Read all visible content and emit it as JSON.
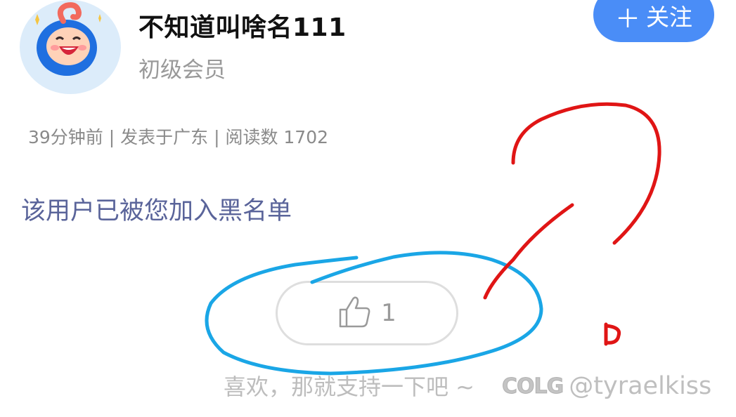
{
  "user": {
    "name": "不知道叫啥名111",
    "level": "初级会员"
  },
  "follow": {
    "icon": "plus-icon",
    "label": "关注",
    "color": "#4a8df7"
  },
  "post_meta": {
    "text": "39分钟前 | 发表于广东 | 阅读数 1702"
  },
  "content": {
    "blocked_notice": "该用户已被您加入黑名单"
  },
  "like": {
    "icon": "thumbs-up-icon",
    "count": "1"
  },
  "footer": {
    "support_text": "喜欢，那就支持一下吧 ~"
  },
  "watermark": {
    "logo": "COLG",
    "handle": "@tyraelkiss"
  },
  "annotations": {
    "blue_color": "#1aa6e6",
    "red_color": "#e01515"
  }
}
